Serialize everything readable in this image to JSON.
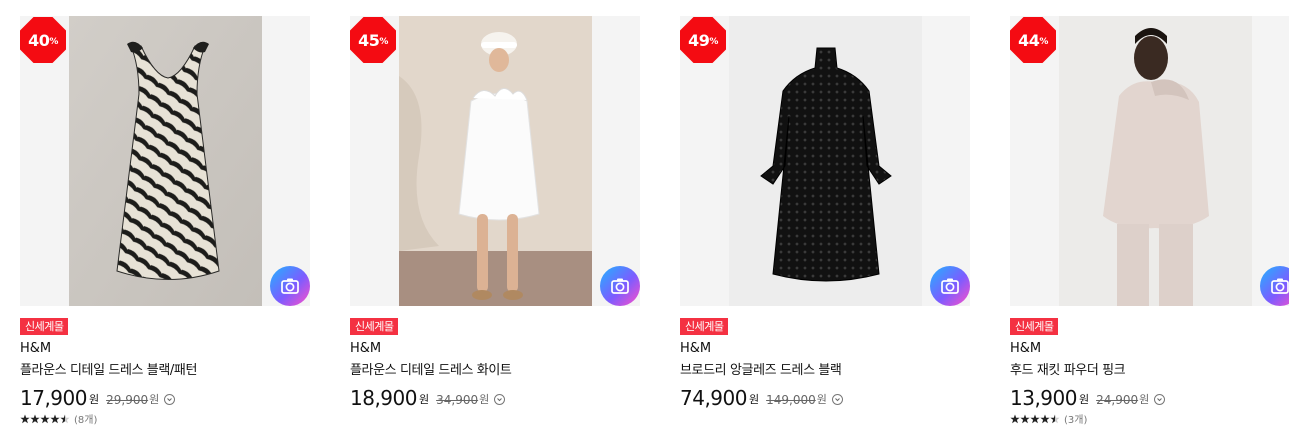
{
  "products": [
    {
      "discount": "40",
      "percent_sign": "%",
      "tag": "신세계몰",
      "brand": "H&M",
      "title": "플라운스 디테일 드레스 블랙/패턴",
      "price": "17,900",
      "currency": "원",
      "original_price": "29,900",
      "rating": 4.5,
      "review_count": "(8개)",
      "photo_bg": "#c9c5bf"
    },
    {
      "discount": "45",
      "percent_sign": "%",
      "tag": "신세계몰",
      "brand": "H&M",
      "title": "플라운스 디테일 드레스 화이트",
      "price": "18,900",
      "currency": "원",
      "original_price": "34,900",
      "rating": null,
      "review_count": "",
      "photo_bg": "#ddd0c4"
    },
    {
      "discount": "49",
      "percent_sign": "%",
      "tag": "신세계몰",
      "brand": "H&M",
      "title": "브로드리 앙글레즈 드레스 블랙",
      "price": "74,900",
      "currency": "원",
      "original_price": "149,000",
      "rating": null,
      "review_count": "",
      "photo_bg": "#eeeeee"
    },
    {
      "discount": "44",
      "percent_sign": "%",
      "tag": "신세계몰",
      "brand": "H&M",
      "title": "후드 재킷 파우더 핑크",
      "price": "13,900",
      "currency": "원",
      "original_price": "24,900",
      "rating": 4.5,
      "review_count": "(3개)",
      "photo_bg": "#ebe9e7"
    }
  ],
  "colors": {
    "badge_red": "#f40b12",
    "tag_red": "#f43142",
    "camera_gradient": [
      "#21b4ff",
      "#7c5cff",
      "#ff4fc8"
    ],
    "star": "#222222"
  },
  "icons": {
    "camera": "camera-search-icon",
    "info": "info-circle-icon",
    "star": "star-icon"
  }
}
